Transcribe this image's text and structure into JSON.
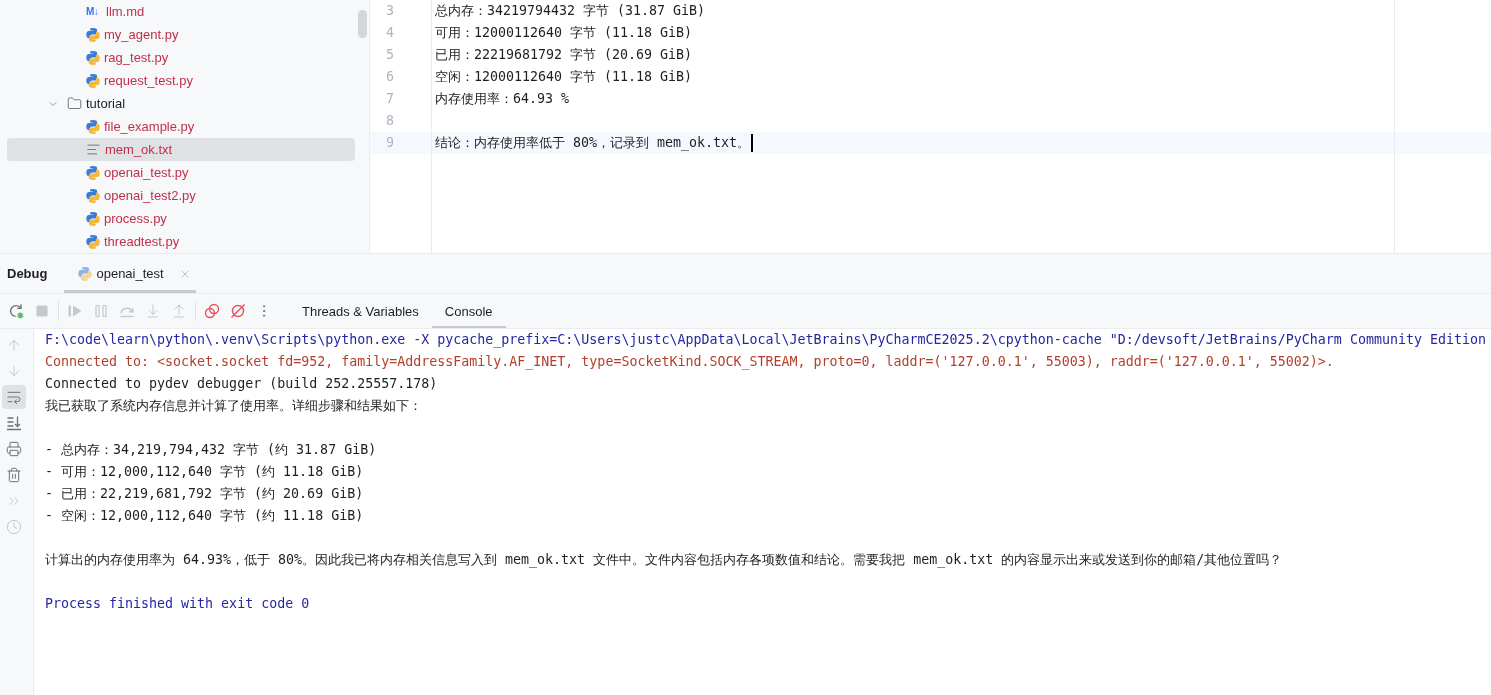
{
  "project_tree": {
    "continued_items": [
      {
        "name": "llm.md",
        "kind": "markdown",
        "icon_label": "M↓",
        "unversioned": true,
        "selected": false
      },
      {
        "name": "my_agent.py",
        "kind": "python",
        "unversioned": true,
        "selected": false
      },
      {
        "name": "rag_test.py",
        "kind": "python",
        "unversioned": true,
        "selected": false
      },
      {
        "name": "request_test.py",
        "kind": "python",
        "unversioned": true,
        "selected": false
      }
    ],
    "items": [
      {
        "name": "tutorial",
        "kind": "folder",
        "expanded": true,
        "unversioned": false,
        "selected": false,
        "children": [
          {
            "name": "file_example.py",
            "kind": "python",
            "unversioned": true,
            "selected": false
          },
          {
            "name": "mem_ok.txt",
            "kind": "text",
            "unversioned": true,
            "selected": true
          },
          {
            "name": "openai_test.py",
            "kind": "python",
            "unversioned": true,
            "selected": false
          },
          {
            "name": "openai_test2.py",
            "kind": "python",
            "unversioned": true,
            "selected": false
          },
          {
            "name": "process.py",
            "kind": "python",
            "unversioned": true,
            "selected": false
          },
          {
            "name": "threadtest.py",
            "kind": "python",
            "unversioned": true,
            "selected": false
          }
        ]
      }
    ]
  },
  "editor": {
    "lines": [
      {
        "number": "3",
        "text": "总内存：34219794432 字节 (31.87 GiB)",
        "current": false
      },
      {
        "number": "4",
        "text": "可用：12000112640 字节 (11.18 GiB)",
        "current": false
      },
      {
        "number": "5",
        "text": "已用：22219681792 字节 (20.69 GiB)",
        "current": false
      },
      {
        "number": "6",
        "text": "空闲：12000112640 字节 (11.18 GiB)",
        "current": false
      },
      {
        "number": "7",
        "text": "内存使用率：64.93 %",
        "current": false
      },
      {
        "number": "8",
        "current": false
      },
      {
        "number": "9",
        "text": "结论：内存使用率低于 80%，记录到 mem_ok.txt。",
        "current": true
      }
    ]
  },
  "debug": {
    "title": "Debug",
    "sessions": [
      {
        "label": "openai_test",
        "selected": true
      }
    ],
    "toolbar_groups": [
      {
        "buttons": [
          {
            "kind": "rerun",
            "disabled": false
          },
          {
            "kind": "stop",
            "disabled": true
          }
        ]
      },
      {
        "buttons": [
          {
            "kind": "resume",
            "disabled": true
          },
          {
            "kind": "pause",
            "disabled": true
          },
          {
            "kind": "step-over",
            "disabled": true
          },
          {
            "kind": "step-into",
            "disabled": true
          },
          {
            "kind": "step-out",
            "disabled": true
          }
        ]
      },
      {
        "buttons": [
          {
            "kind": "view-breakpoints",
            "disabled": false
          },
          {
            "kind": "mute-breakpoints",
            "disabled": false
          },
          {
            "kind": "more",
            "disabled": false
          }
        ]
      }
    ],
    "tabs": [
      {
        "label": "Threads & Variables",
        "selected": false
      },
      {
        "label": "Console",
        "selected": true
      }
    ],
    "console_tools": [
      {
        "kind": "up",
        "disabled": true,
        "on": false
      },
      {
        "kind": "down",
        "disabled": true,
        "on": false
      },
      {
        "kind": "soft-wrap",
        "disabled": false,
        "on": true
      },
      {
        "kind": "scroll-to-end",
        "disabled": false,
        "on": false
      },
      {
        "kind": "print",
        "disabled": false,
        "on": false
      },
      {
        "kind": "clear",
        "disabled": false,
        "on": false
      },
      {
        "kind": "overflow",
        "disabled": true,
        "on": false
      },
      {
        "kind": "history",
        "disabled": true,
        "on": false
      }
    ],
    "console": {
      "lines": [
        {
          "kind": "system",
          "text": "F:\\code\\learn\\python\\.venv\\Scripts\\python.exe -X pycache_prefix=C:\\Users\\justc\\AppData\\Local\\JetBrains\\PyCharmCE2025.2\\cpython-cache \"D:/devsoft/JetBrains/PyCharm Community Edition"
        },
        {
          "kind": "stderr",
          "text": "Connected to: <socket.socket fd=952, family=AddressFamily.AF_INET, type=SocketKind.SOCK_STREAM, proto=0, laddr=('127.0.0.1', 55003), raddr=('127.0.0.1', 55002)>."
        },
        {
          "kind": "stdout",
          "text": "Connected to pydev debugger (build 252.25557.178)"
        },
        {
          "kind": "stdout",
          "text": "我已获取了系统内存信息并计算了使用率。详细步骤和结果如下："
        },
        {
          "kind": "blank"
        },
        {
          "kind": "stdout",
          "text": "- 总内存：34,219,794,432 字节 (约 31.87 GiB)"
        },
        {
          "kind": "stdout",
          "text": "- 可用：12,000,112,640 字节 (约 11.18 GiB)"
        },
        {
          "kind": "stdout",
          "text": "- 已用：22,219,681,792 字节 (约 20.69 GiB)"
        },
        {
          "kind": "stdout",
          "text": "- 空闲：12,000,112,640 字节 (约 11.18 GiB)"
        },
        {
          "kind": "blank"
        },
        {
          "kind": "stdout",
          "text": "计算出的内存使用率为 64.93%，低于 80%。因此我已将内存相关信息写入到 mem_ok.txt 文件中。文件内容包括内存各项数值和结论。需要我把 mem_ok.txt 的内容显示出来或发送到你的邮箱/其他位置吗？"
        },
        {
          "kind": "blank"
        },
        {
          "kind": "system",
          "text": "Process finished with exit code 0"
        }
      ]
    }
  }
}
